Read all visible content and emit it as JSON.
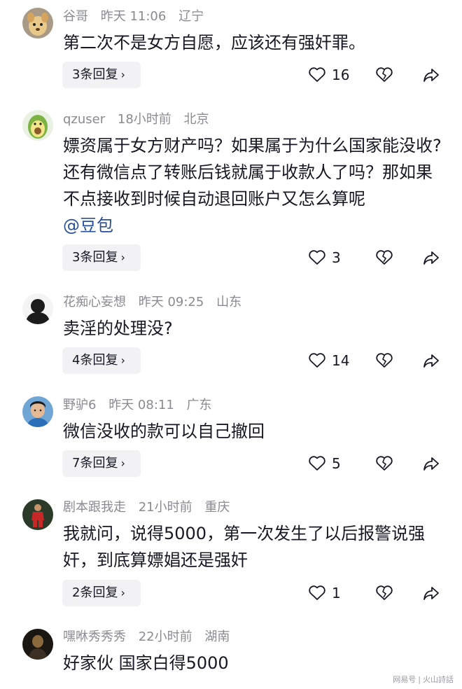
{
  "comments": [
    {
      "author": "谷哥",
      "time": "昨天 11:06",
      "location": "辽宁",
      "text": "第二次不是女方自愿，应该还有强奸罪。",
      "mention": "",
      "replies": "3条回复",
      "likes": "16",
      "avatar_icon": "dog-avatar"
    },
    {
      "author": "qzuser",
      "time": "18小时前",
      "location": "北京",
      "text": "嫖资属于女方财产吗？如果属于为什么国家能没收?还有微信点了转账后钱就属于收款人了吗？那如果不点接收到时候自动退回账户又怎么算呢",
      "mention": "@豆包",
      "replies": "3条回复",
      "likes": "3",
      "avatar_icon": "avocado-avatar"
    },
    {
      "author": "花痴心妄想",
      "time": "昨天 09:25",
      "location": "山东",
      "text": "卖淫的处理没?",
      "mention": "",
      "replies": "4条回复",
      "likes": "14",
      "avatar_icon": "silhouette-avatar"
    },
    {
      "author": "野驴6",
      "time": "昨天 08:11",
      "location": "广东",
      "text": "微信没收的款可以自己撤回",
      "mention": "",
      "replies": "7条回复",
      "likes": "5",
      "avatar_icon": "boy-avatar"
    },
    {
      "author": "剧本跟我走",
      "time": "21小时前",
      "location": "重庆",
      "text": "我就问，说得5000，第一次发生了以后报警说强奸，到底算嫖娼还是强奸",
      "mention": "",
      "replies": "2条回复",
      "likes": "1",
      "avatar_icon": "soccer-player-avatar"
    },
    {
      "author": "嘿咻秀秀秀",
      "time": "22小时前",
      "location": "湖南",
      "text": "好家伙 国家白得5000",
      "mention": "",
      "replies": "",
      "likes": "",
      "avatar_icon": "dark-figure-avatar"
    }
  ],
  "watermark": {
    "left": "网易号",
    "right": "火山詩話"
  }
}
